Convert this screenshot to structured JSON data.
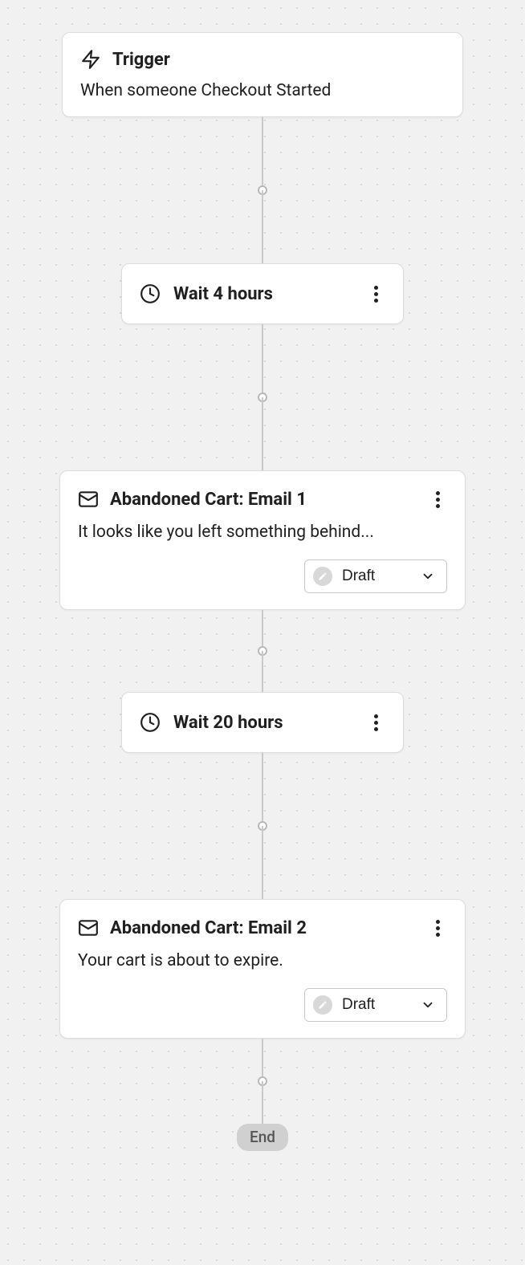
{
  "trigger": {
    "title": "Trigger",
    "description": "When someone Checkout Started"
  },
  "steps": [
    {
      "type": "wait",
      "label": "Wait 4 hours"
    },
    {
      "type": "email",
      "title": "Abandoned Cart: Email 1",
      "description": "It looks like you left something behind...",
      "status": "Draft"
    },
    {
      "type": "wait",
      "label": "Wait 20 hours"
    },
    {
      "type": "email",
      "title": "Abandoned Cart: Email 2",
      "description": "Your cart is about to expire.",
      "status": "Draft"
    }
  ],
  "end_label": "End"
}
